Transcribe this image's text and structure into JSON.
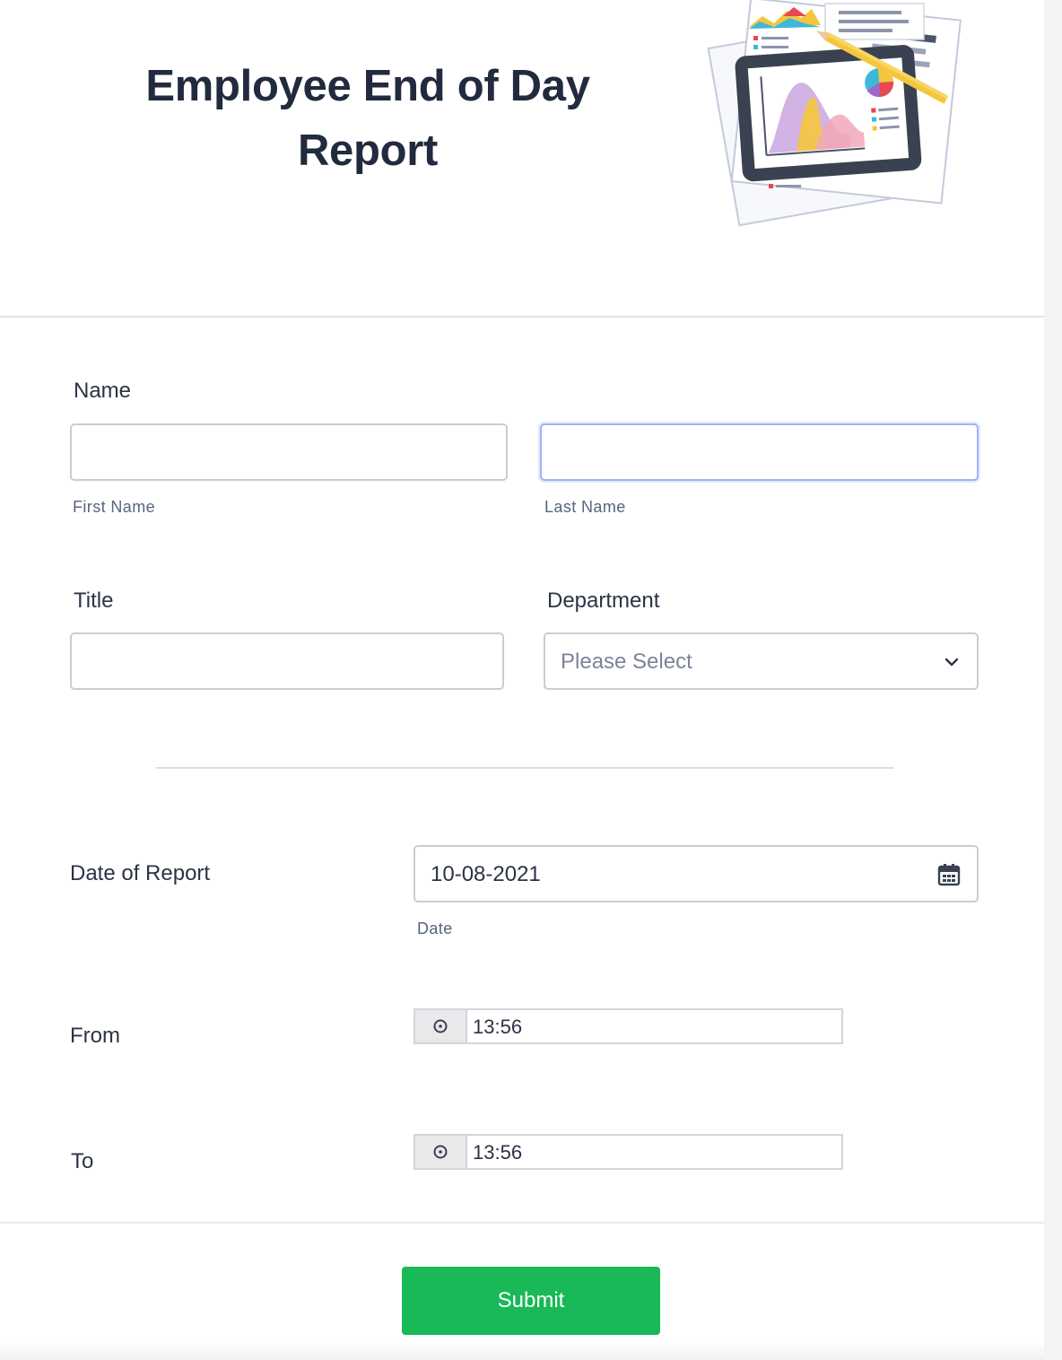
{
  "form": {
    "title": "Employee End of Day Report",
    "fields": {
      "name": {
        "label": "Name",
        "first_sublabel": "First Name",
        "last_sublabel": "Last Name",
        "first_value": "",
        "last_value": ""
      },
      "title": {
        "label": "Title",
        "value": ""
      },
      "department": {
        "label": "Department",
        "selected": "Please Select"
      },
      "date_of_report": {
        "label": "Date of Report",
        "value": "10-08-2021",
        "sublabel": "Date"
      },
      "from": {
        "label": "From",
        "value": "13:56"
      },
      "to": {
        "label": "To",
        "value": "13:56"
      }
    },
    "submit_label": "Submit"
  },
  "icons": {
    "header_illustration": "report-illustration",
    "department_select": "chevron-down-icon",
    "date_picker": "calendar-icon",
    "time_picker": "clock-icon"
  },
  "colors": {
    "submit_bg": "#18b956",
    "title_text": "#212a3e",
    "focus_border": "#9fb3f5"
  }
}
